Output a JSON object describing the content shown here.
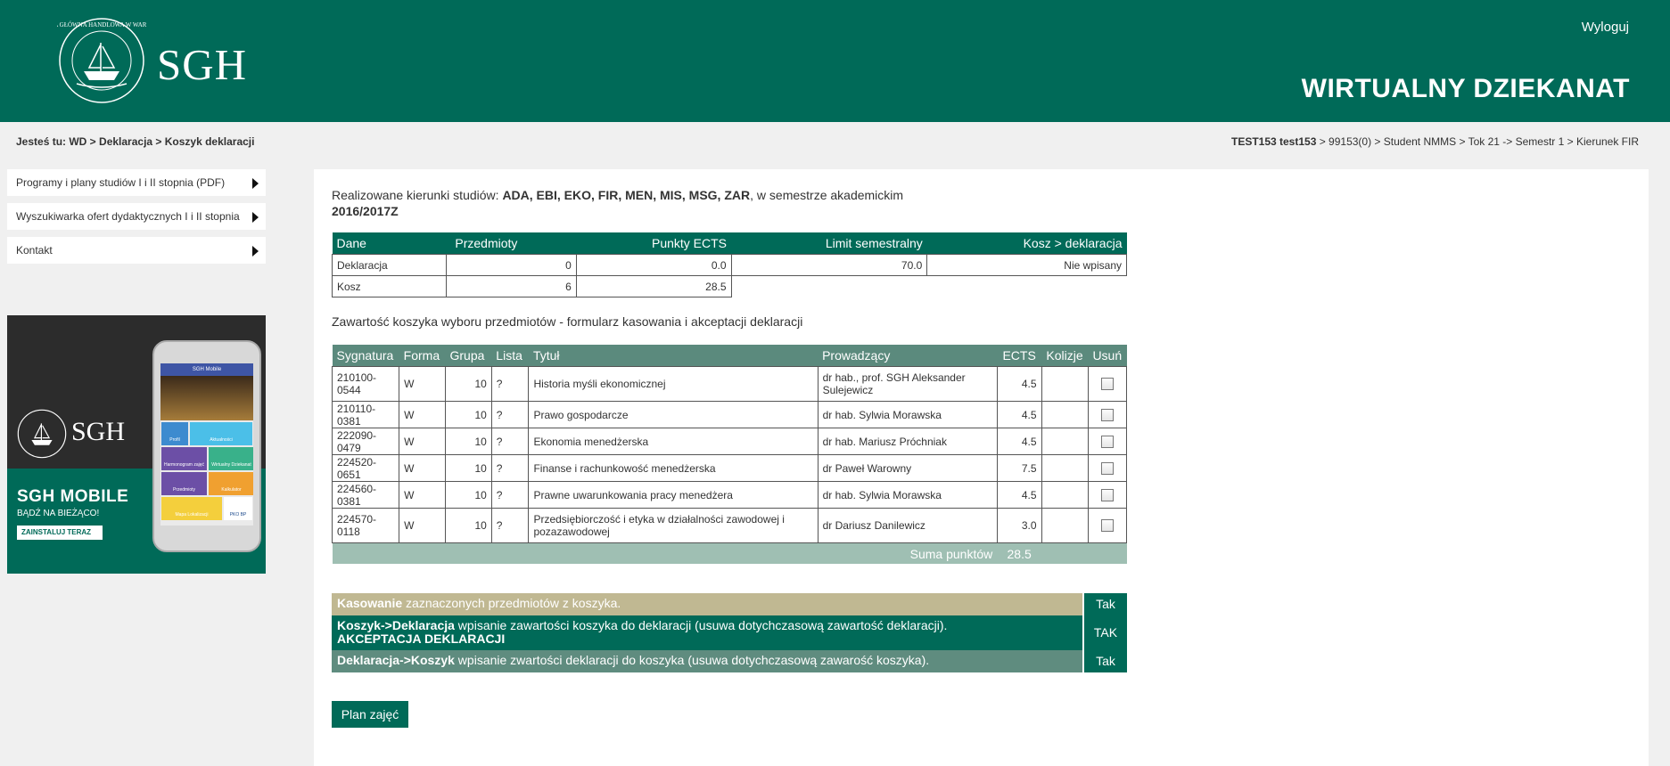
{
  "header": {
    "logo_text": "SGH",
    "seal_text": "SZKOŁA GŁÓWNA HANDLOWA W WARSZAWIE",
    "logout": "Wyloguj",
    "app_title": "WIRTUALNY DZIEKANAT",
    "brand_color": "#006a58"
  },
  "breadcrumb": "Jesteś tu: WD > Deklaracja > Koszyk deklaracji",
  "user_info": {
    "name": "TEST153 test153",
    "details": " > 99153(0) > Student NMMS > Tok 21 -> Semestr 1 > Kierunek FIR"
  },
  "sidebar": {
    "items": [
      {
        "label": "Programy i plany studiów I i II stopnia (PDF)"
      },
      {
        "label": "Wyszukiwarka ofert dydaktycznych I i II stopnia"
      },
      {
        "label": "Kontakt"
      }
    ]
  },
  "banner": {
    "logo": "SGH",
    "title": "SGH MOBILE",
    "subtitle": "BĄDŹ NA BIEŻĄCO!",
    "button": "ZAINSTALUJ TERAZ",
    "phone_header": "SGH Mobile",
    "tiles": [
      "Profil",
      "Aktualności",
      "Harmonogram zajęć",
      "Wirtualny Dziekanat",
      "Przedmioty",
      "Kalkulator",
      "Mapa Lokalizacji",
      "PKO BP"
    ]
  },
  "intro": {
    "prefix": "Realizowane kierunki studiów: ",
    "fields": "ADA, EBI, EKO, FIR, MEN, MIS, MSG, ZAR",
    "suffix": ", w semestrze akademickim",
    "semester": "2016/2017Z"
  },
  "summary_table": {
    "headers": [
      "Dane",
      "Przedmioty",
      "Punkty ECTS",
      "Limit semestralny",
      "Kosz > deklaracja"
    ],
    "rows": [
      [
        "Deklaracja",
        "0",
        "0.0",
        "70.0",
        "Nie wpisany"
      ],
      [
        "Kosz",
        "6",
        "28.5",
        "",
        ""
      ]
    ]
  },
  "subtitle": "Zawartość koszyka wyboru przedmiotów - formularz kasowania i akceptacji deklaracji",
  "courses_table": {
    "headers": [
      "Sygnatura",
      "Forma",
      "Grupa",
      "Lista",
      "Tytuł",
      "Prowadzący",
      "ECTS",
      "Kolizje",
      "Usuń"
    ],
    "rows": [
      {
        "sig": "210100-0544",
        "forma": "W",
        "grupa": "10",
        "lista": "?",
        "tytul": "Historia myśli ekonomicznej",
        "prow": "dr hab., prof. SGH Aleksander Sulejewicz",
        "ects": "4.5",
        "kolizje": "",
        "tall": true
      },
      {
        "sig": "210110-0381",
        "forma": "W",
        "grupa": "10",
        "lista": "?",
        "tytul": "Prawo gospodarcze",
        "prow": "dr hab. Sylwia Morawska",
        "ects": "4.5",
        "kolizje": "",
        "tall": false
      },
      {
        "sig": "222090-0479",
        "forma": "W",
        "grupa": "10",
        "lista": "?",
        "tytul": "Ekonomia menedżerska",
        "prow": "dr hab. Mariusz Próchniak",
        "ects": "4.5",
        "kolizje": "",
        "tall": false
      },
      {
        "sig": "224520-0651",
        "forma": "W",
        "grupa": "10",
        "lista": "?",
        "tytul": "Finanse i rachunkowość menedżerska",
        "prow": "dr Paweł Warowny",
        "ects": "7.5",
        "kolizje": "",
        "tall": false
      },
      {
        "sig": "224560-0381",
        "forma": "W",
        "grupa": "10",
        "lista": "?",
        "tytul": "Prawne uwarunkowania pracy menedżera",
        "prow": "dr hab. Sylwia Morawska",
        "ects": "4.5",
        "kolizje": "",
        "tall": false
      },
      {
        "sig": "224570-0118",
        "forma": "W",
        "grupa": "10",
        "lista": "?",
        "tytul": "Przedsiębiorczość i etyka w działalności zawodowej i pozazawodowej",
        "prow": "dr Dariusz Danilewicz",
        "ects": "3.0",
        "kolizje": "",
        "tall": true
      }
    ],
    "sum_label": "Suma punktów",
    "sum_value": "28.5"
  },
  "actions": {
    "a1_bold": "Kasowanie",
    "a1_text": " zaznaczonych przedmiotów z koszyka.",
    "a1_btn": "Tak",
    "a2_bold": "Koszyk->Deklaracja",
    "a2_text": " wpisanie zawartości koszyka do deklaracji (usuwa dotychczasową zawartość deklaracji).",
    "a2_line2": "AKCEPTACJA DEKLARACJI",
    "a2_btn": "TAK",
    "a3_bold": "Deklaracja->Koszyk",
    "a3_text": " wpisanie zwartości deklaracji do koszyka (usuwa dotychczasową zawarość koszyka).",
    "a3_btn": "Tak"
  },
  "plan_button": "Plan zajęć"
}
